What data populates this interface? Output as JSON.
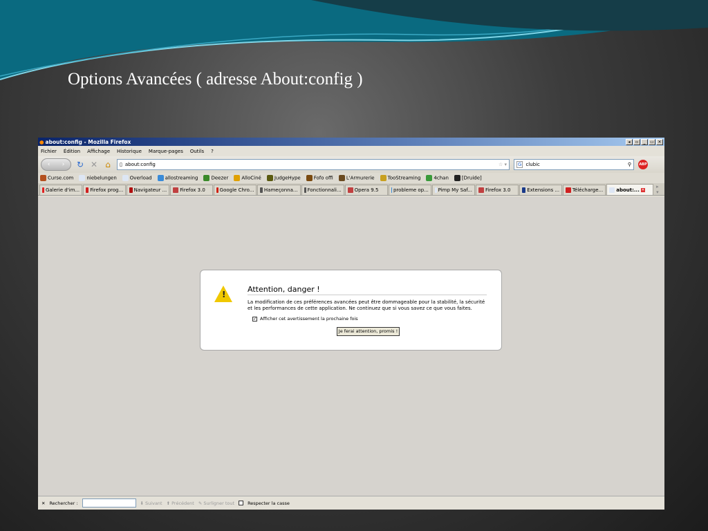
{
  "slide": {
    "title": "Options Avancées ( adresse About:config )"
  },
  "window": {
    "title": "about:config - Mozilla Firefox",
    "buttons": [
      "◂",
      "▫",
      "_",
      "▭",
      "✕"
    ]
  },
  "menu": [
    "Fichier",
    "Édition",
    "Affichage",
    "Historique",
    "Marque-pages",
    "Outils",
    "?"
  ],
  "nav": {
    "url": "about:config",
    "search_value": "clubic",
    "search_engine": "G",
    "adblock": "ABP"
  },
  "bookmarks": [
    {
      "label": "Curse.com",
      "color": "#b4501e"
    },
    {
      "label": "niebelungen",
      "color": "#dde6f4"
    },
    {
      "label": "Overload",
      "color": "#dde6f4"
    },
    {
      "label": "allostreaming",
      "color": "#3a8bd8"
    },
    {
      "label": "Deezer",
      "color": "#3b8a2a"
    },
    {
      "label": "AlloCiné",
      "color": "#e0a000"
    },
    {
      "label": "JudgeHype",
      "color": "#5a5a10"
    },
    {
      "label": "Fofo offi",
      "color": "#7a4a10"
    },
    {
      "label": "L'Armurerie",
      "color": "#6a4a20"
    },
    {
      "label": "TooStreaming",
      "color": "#c8a020"
    },
    {
      "label": "4chan",
      "color": "#3a9a3a"
    },
    {
      "label": "[Druide]",
      "color": "#222"
    }
  ],
  "tabs": [
    {
      "label": "Galerie d'im...",
      "color": "#e02020"
    },
    {
      "label": "Firefox prog...",
      "color": "#d02020"
    },
    {
      "label": "Navigateur ...",
      "color": "#b01010"
    },
    {
      "label": "Firefox 3.0",
      "color": "#c04040"
    },
    {
      "label": "Google Chro...",
      "color": "#d02010"
    },
    {
      "label": "Hameçonna...",
      "color": "#555"
    },
    {
      "label": "Fonctionnali...",
      "color": "#555"
    },
    {
      "label": "Opera 9.5",
      "color": "#c04040"
    },
    {
      "label": "probleme op...",
      "color": "#3a8bd8"
    },
    {
      "label": "Pimp My Saf...",
      "color": "#dde6f4"
    },
    {
      "label": "Firefox 3.0",
      "color": "#c04040"
    },
    {
      "label": "Extensions ...",
      "color": "#1a3a8a"
    },
    {
      "label": "Télécharge...",
      "color": "#d02020"
    },
    {
      "label": "about:...",
      "color": "#dde6f4",
      "active": true
    }
  ],
  "dialog": {
    "title": "Attention, danger !",
    "text": "La modification de ces préférences avancées peut être dommageable pour la stabilité, la sécurité et les performances de cette application. Ne continuez que si vous savez ce que vous faites.",
    "checkbox_label": "Afficher cet avertissement la prochaine fois",
    "checkbox_checked": true,
    "button": "Je ferai attention, promis !"
  },
  "findbar": {
    "label": "Rechercher :",
    "next": "Suivant",
    "prev": "Précédent",
    "highlight": "Surligner tout",
    "match_case": "Respecter la casse"
  }
}
